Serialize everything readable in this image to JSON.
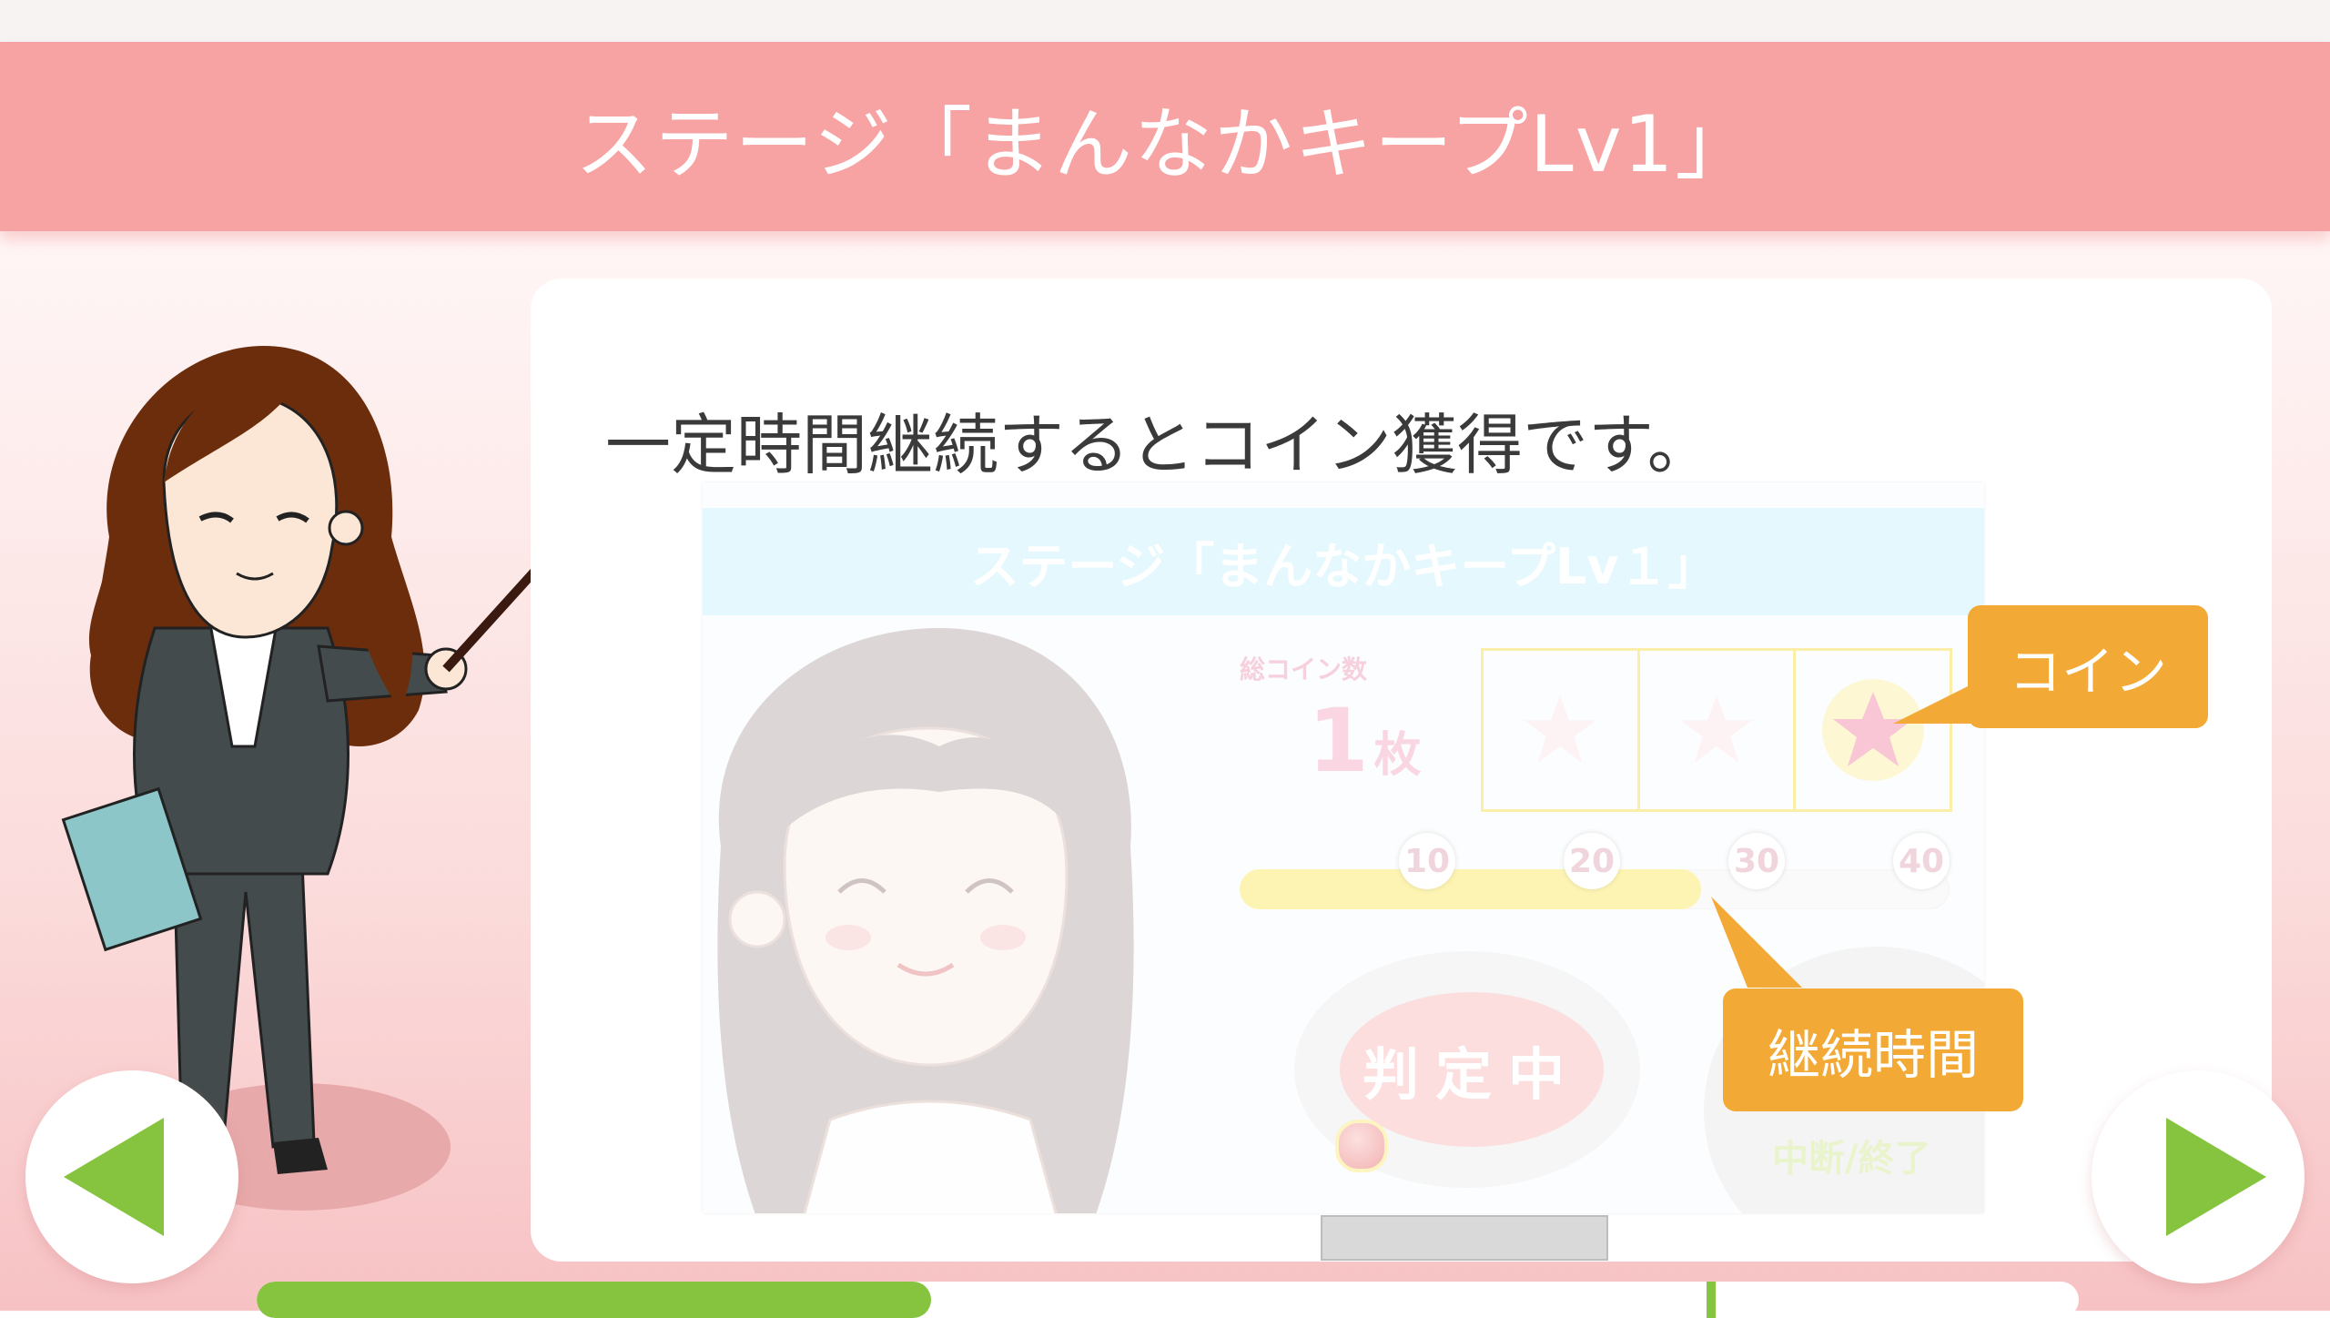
{
  "stage_title": "ステージ「まんなかキープLv1」",
  "description": "一定時間継続するとコイン獲得です。",
  "preview": {
    "title": "ステージ「まんなかキープLv１」",
    "coin_label": "総コイン数",
    "coin_count": "1",
    "coin_unit": "枚",
    "time_ticks": [
      "10",
      "20",
      "30",
      "40"
    ],
    "time_fill_fraction": 0.65,
    "judge_label": "判定中",
    "stop_label": "中断/終了"
  },
  "callouts": {
    "coin": "コイン",
    "duration": "継続時間"
  },
  "progress": {
    "fraction": 0.37
  },
  "colors": {
    "title_bar": "#f7a3a3",
    "callout": "#f3a935",
    "nav_arrow": "#86c440",
    "progress": "#86c440"
  },
  "icons": {
    "prev": "left-triangle-icon",
    "next": "right-triangle-icon",
    "coin": "star-icon"
  }
}
